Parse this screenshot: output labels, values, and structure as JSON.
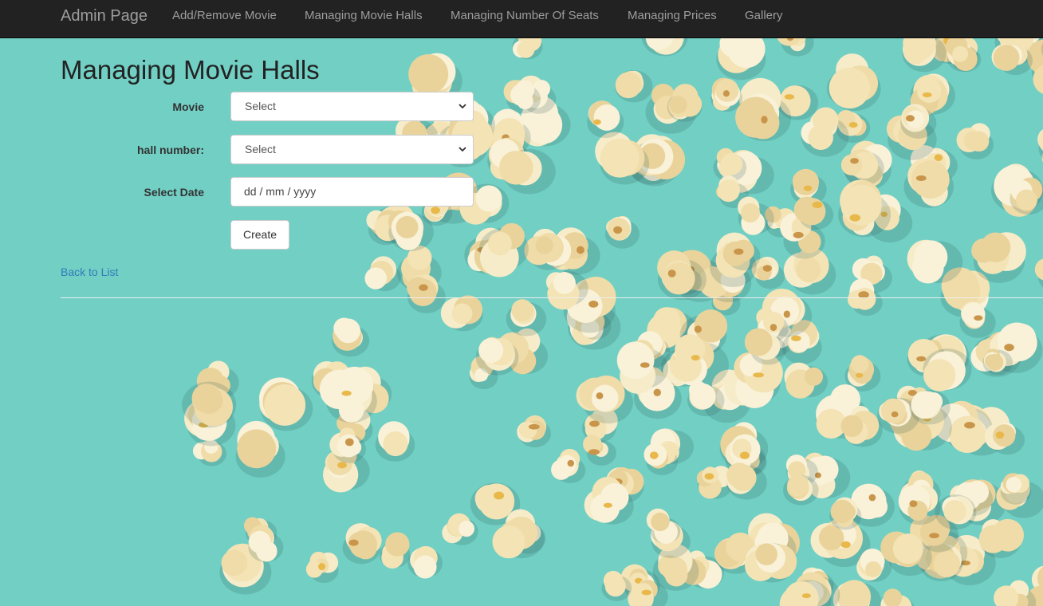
{
  "navbar": {
    "brand": "Admin Page",
    "links": [
      "Add/Remove Movie",
      "Managing Movie Halls",
      "Managing Number Of Seats",
      "Managing Prices",
      "Gallery"
    ]
  },
  "page": {
    "title": "Managing Movie Halls"
  },
  "form": {
    "movie": {
      "label": "Movie",
      "value": "Select"
    },
    "hall": {
      "label": "hall number:",
      "value": "Select"
    },
    "date": {
      "label": "Select Date",
      "placeholder": "dd / mm / yyyy"
    },
    "submit_label": "Create"
  },
  "back_link": "Back to List",
  "background": {
    "subject": "popcorn",
    "base_color": "#72cfc4",
    "kernel_color": "#f7ecc9"
  }
}
